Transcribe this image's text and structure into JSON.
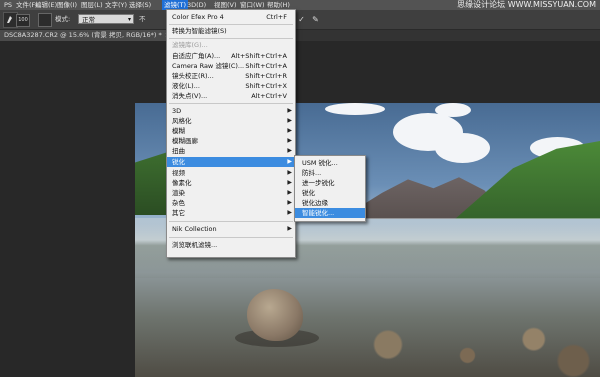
{
  "menubar": {
    "items": [
      "PS",
      "文件(F)",
      "编辑(E)",
      "图像(I)",
      "图层(L)",
      "文字(Y)",
      "选择(S)",
      "滤镜(T)",
      "3D(D)",
      "视图(V)",
      "窗口(W)",
      "帮助(H)"
    ],
    "active_index": 7,
    "watermark": "思缘设计论坛 WWW.MISSYUAN.COM"
  },
  "optionsbar": {
    "brush_size": "100",
    "mode_label": "模式:",
    "mode_value": "正常",
    "truncated_label": "不"
  },
  "document": {
    "tab_title": "DSC8A3287.CR2 @ 15.6% (背景 拷贝, RGB/16*) *",
    "close_glyph": "×"
  },
  "filter_menu": {
    "last_filter": {
      "label": "Color Efex Pro 4",
      "shortcut": "Ctrl+F"
    },
    "convert_smart": "转换为智能滤镜(S)",
    "gallery": "滤镜库(G)...",
    "adaptive_wide": {
      "label": "自适应广角(A)...",
      "shortcut": "Alt+Shift+Ctrl+A"
    },
    "camera_raw": {
      "label": "Camera Raw 滤镜(C)...",
      "shortcut": "Shift+Ctrl+A"
    },
    "lens_correction": {
      "label": "镜头校正(R)...",
      "shortcut": "Shift+Ctrl+R"
    },
    "liquify": {
      "label": "液化(L)...",
      "shortcut": "Shift+Ctrl+X"
    },
    "vanishing_point": {
      "label": "消失点(V)...",
      "shortcut": "Alt+Ctrl+V"
    },
    "submenus": [
      "3D",
      "风格化",
      "模糊",
      "模糊画廊",
      "扭曲",
      "锐化",
      "视频",
      "像素化",
      "渲染",
      "杂色",
      "其它"
    ],
    "active_submenu_index": 5,
    "nik": "Nik Collection",
    "browse_online": "浏览联机滤镜..."
  },
  "sharpen_submenu": {
    "items": [
      "USM 锐化...",
      "防抖...",
      "进一步锐化",
      "锐化",
      "锐化边缘",
      "智能锐化..."
    ],
    "active_index": 5
  },
  "colors": {
    "menu_highlight": "#3c8ce0",
    "menubar_active": "#1f6fd6"
  }
}
